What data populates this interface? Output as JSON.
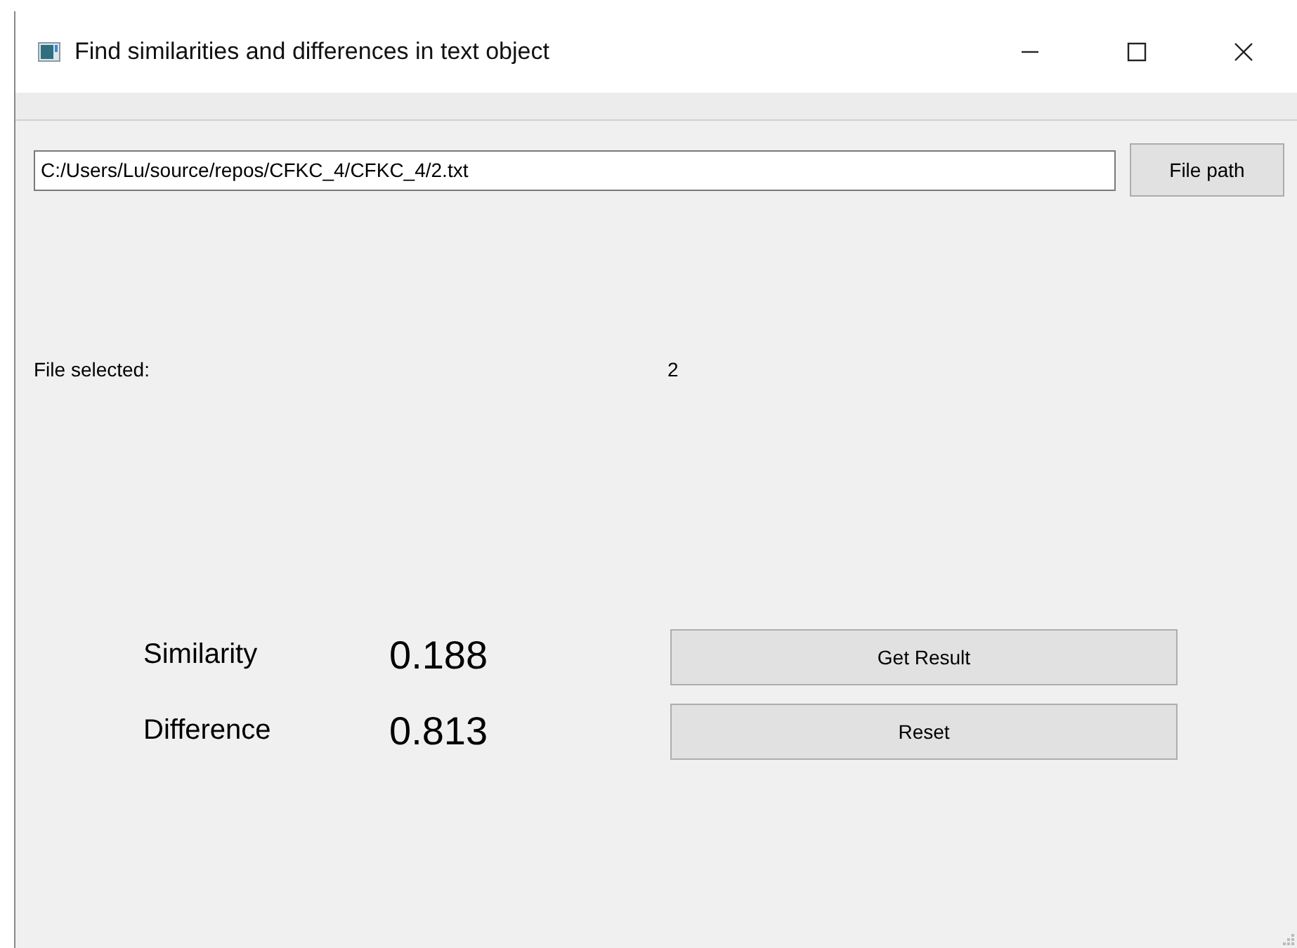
{
  "window": {
    "title": "Find similarities and differences in text object"
  },
  "file_path": {
    "value": "C:/Users/Lu/source/repos/CFKC_4/CFKC_4/2.txt",
    "button": "File path"
  },
  "file_selected": {
    "label": "File selected:",
    "value": "2"
  },
  "results": [
    {
      "label": "Similarity",
      "value": "0.188"
    },
    {
      "label": "Difference",
      "value": "0.813"
    }
  ],
  "buttons": [
    "Get Result",
    "Reset"
  ]
}
